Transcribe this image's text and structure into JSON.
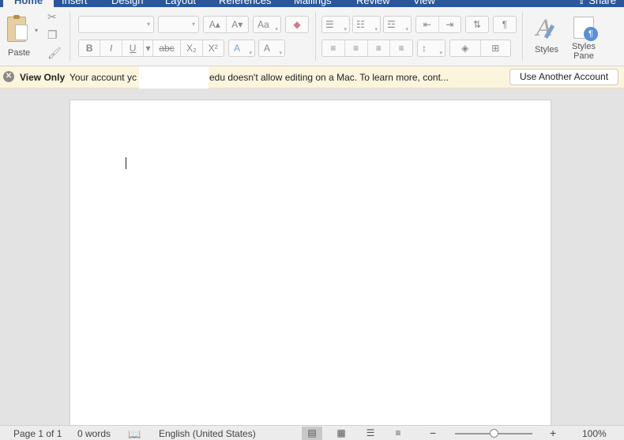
{
  "ribbon": {
    "tabs": [
      "Home",
      "Insert",
      "Design",
      "Layout",
      "References",
      "Mailings",
      "Review",
      "View"
    ],
    "active_tab": "Home",
    "share_label": "Share",
    "paste_label": "Paste",
    "styles_label": "Styles",
    "styles_pane_label_1": "Styles",
    "styles_pane_label_2": "Pane",
    "format_buttons": {
      "bold": "B",
      "italic": "I",
      "underline": "U",
      "strike": "abc",
      "subscript": "X₂",
      "superscript": "X²",
      "grow_font": "A▴",
      "shrink_font": "A▾",
      "case": "Aa",
      "text_effects": "A",
      "font_color": "A",
      "pilcrow": "¶"
    }
  },
  "message_bar": {
    "title": "View Only",
    "text_a": "Your account yc",
    "text_b": "edu doesn't allow editing on a Mac. To learn more, cont...",
    "button_label": "Use Another Account"
  },
  "status": {
    "page": "Page 1 of 1",
    "words": "0 words",
    "language": "English (United States)",
    "zoom_minus": "−",
    "zoom_plus": "+",
    "zoom": "100%"
  }
}
